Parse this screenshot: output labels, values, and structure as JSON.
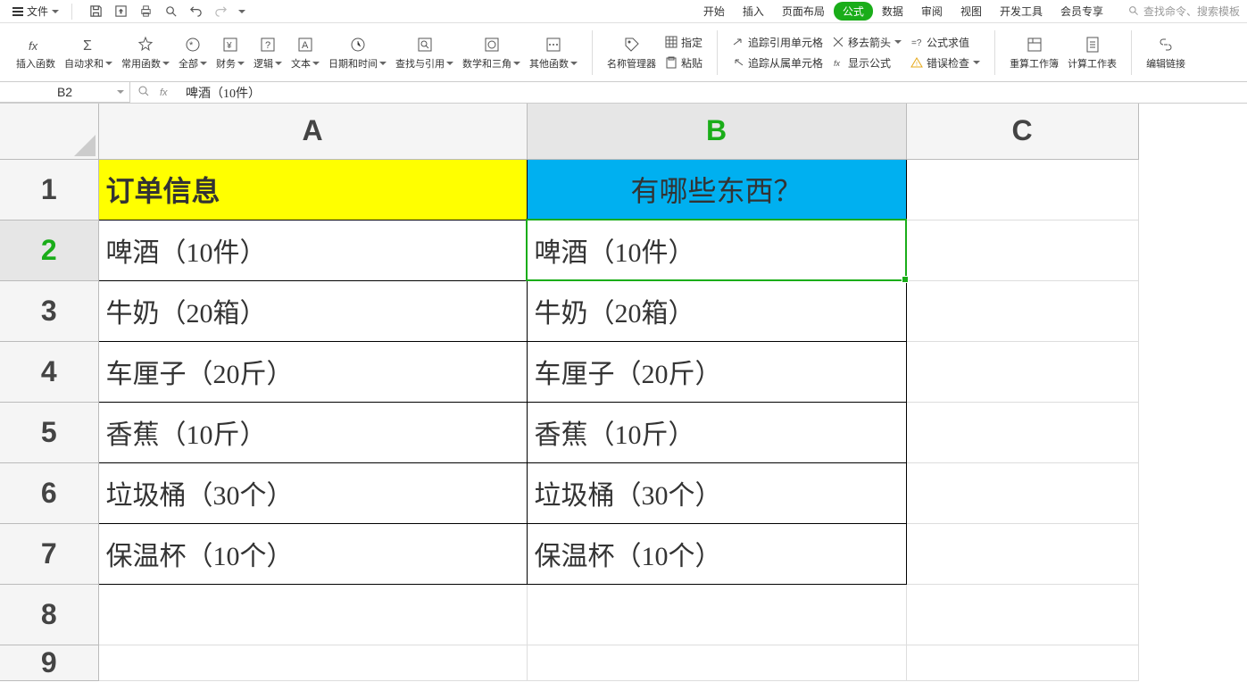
{
  "menu": {
    "file": "文件",
    "tabs": [
      "开始",
      "插入",
      "页面布局",
      "公式",
      "数据",
      "审阅",
      "视图",
      "开发工具",
      "会员专享"
    ],
    "active_tab": 3,
    "search_placeholder": "查找命令、搜索模板"
  },
  "ribbon": {
    "insert_func": "插入函数",
    "autosum": "自动求和",
    "common": "常用函数",
    "all": "全部",
    "finance": "财务",
    "logic": "逻辑",
    "text": "文本",
    "datetime": "日期和时间",
    "lookup": "查找与引用",
    "math": "数学和三角",
    "other": "其他函数",
    "name_mgr": "名称管理器",
    "define": "指定",
    "paste": "粘贴",
    "trace_prec": "追踪引用单元格",
    "trace_dep": "追踪从属单元格",
    "remove_arrows": "移去箭头",
    "show_formula": "显示公式",
    "formula_eval": "公式求值",
    "error_check": "错误检查",
    "recalc_book": "重算工作簿",
    "calc_sheet": "计算工作表",
    "edit_link": "编辑链接"
  },
  "formula_bar": {
    "name_box": "B2",
    "formula": "啤酒（10件）"
  },
  "columns": [
    "A",
    "B",
    "C"
  ],
  "rows": [
    "1",
    "2",
    "3",
    "4",
    "5",
    "6",
    "7",
    "8"
  ],
  "headers": {
    "A1": "订单信息",
    "B1": "有哪些东西？"
  },
  "cells": {
    "A2": "啤酒（10件）",
    "B2": "啤酒（10件）",
    "A3": "牛奶（20箱）",
    "B3": "牛奶（20箱）",
    "A4": "车厘子（20斤）",
    "B4": "车厘子（20斤）",
    "A5": "香蕉（10斤）",
    "B5": "香蕉（10斤）",
    "A6": "垃圾桶（30个）",
    "B6": "垃圾桶（30个）",
    "A7": "保温杯（10个）",
    "B7": "保温杯（10个）"
  },
  "chart_data": {
    "type": "table",
    "title": "订单信息",
    "columns": [
      "订单信息",
      "有哪些东西？"
    ],
    "rows": [
      [
        "啤酒（10件）",
        "啤酒（10件）"
      ],
      [
        "牛奶（20箱）",
        "牛奶（20箱）"
      ],
      [
        "车厘子（20斤）",
        "车厘子（20斤）"
      ],
      [
        "香蕉（10斤）",
        "香蕉（10斤）"
      ],
      [
        "垃圾桶（30个）",
        "垃圾桶（30个）"
      ],
      [
        "保温杯（10个）",
        "保温杯（10个）"
      ]
    ]
  }
}
